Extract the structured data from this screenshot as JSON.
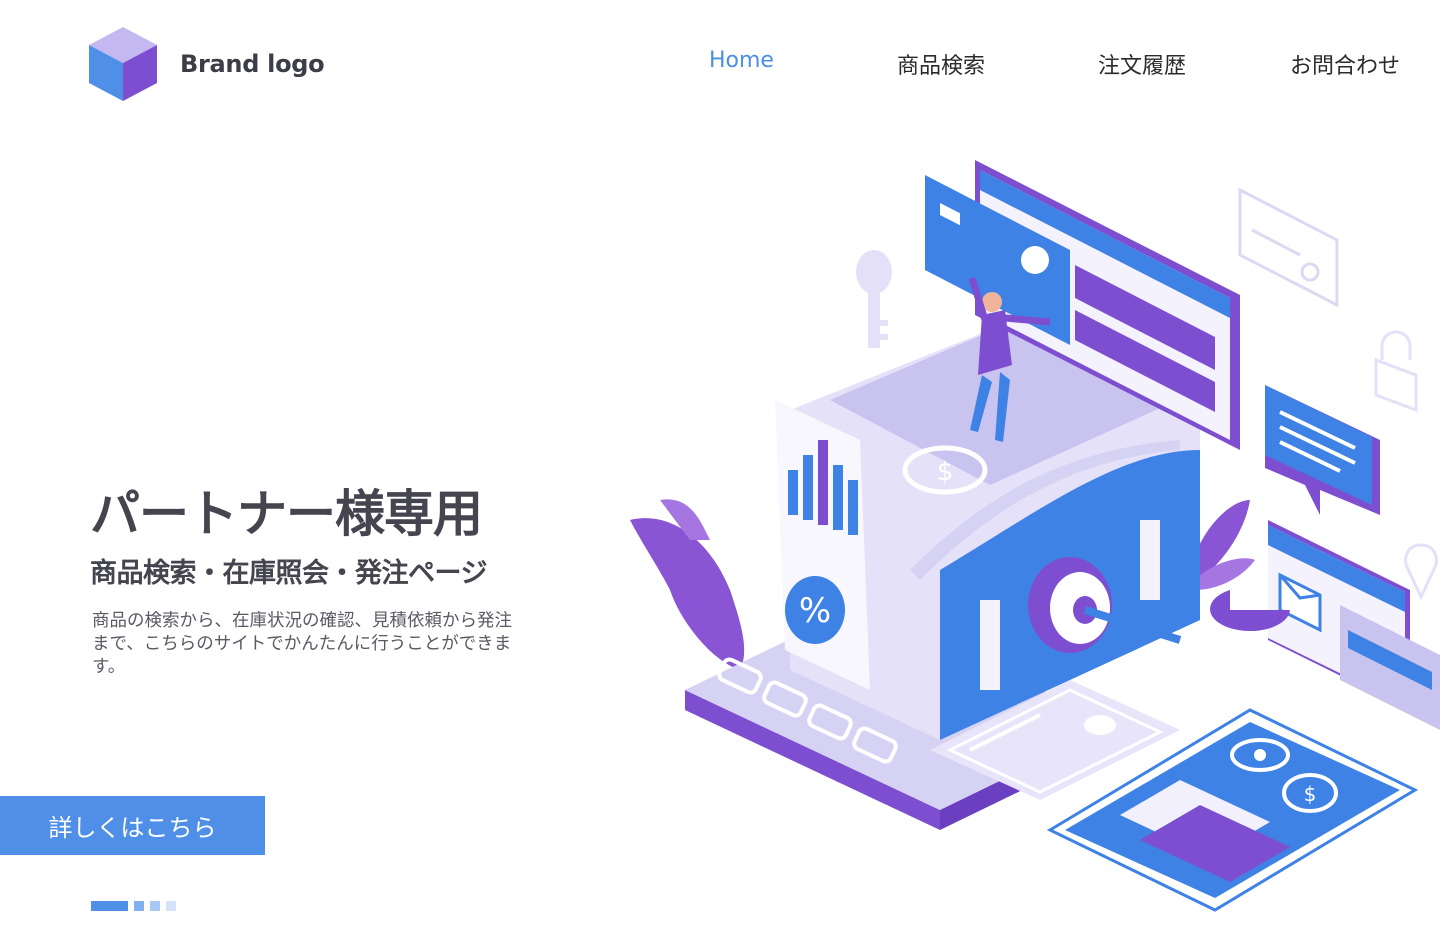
{
  "brand": {
    "name": "Brand logo",
    "logo_icon": "cube-icon"
  },
  "nav": {
    "items": [
      {
        "label": "Home",
        "active": true
      },
      {
        "label": "商品検索",
        "active": false
      },
      {
        "label": "注文履歴",
        "active": false
      },
      {
        "label": "お問合わせ",
        "active": false
      }
    ]
  },
  "hero": {
    "title": "パートナー様専用",
    "subtitle": "商品検索・在庫照会・発注ページ",
    "description": "商品の検索から、在庫状況の確認、見積依頼から発注まで、こちらのサイトでかんたんに行うことができます。",
    "cta_label": "詳しくはこちら"
  },
  "pager": {
    "total": 4,
    "active_index": 0
  },
  "colors": {
    "accent": "#4f8fe8",
    "purple": "#7d4fd0",
    "lavender": "#dcd8f5",
    "text_dark": "#45454f"
  }
}
